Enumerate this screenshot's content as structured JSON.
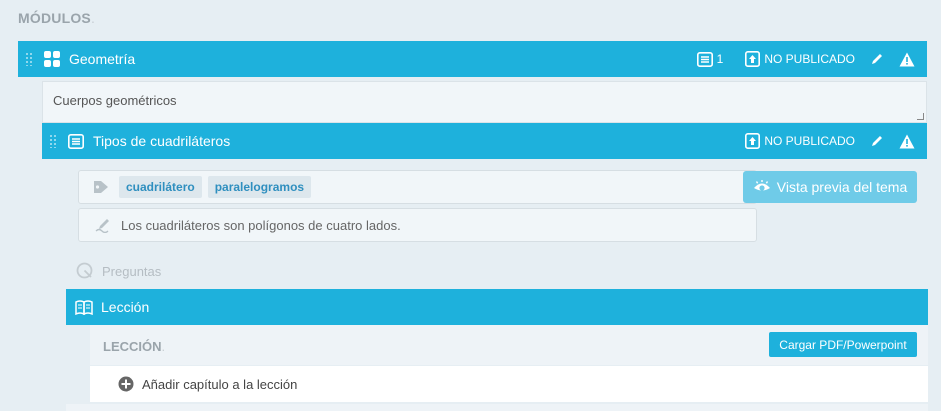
{
  "section": {
    "title": "MÓDULOS"
  },
  "module": {
    "title": "Geometría",
    "count": "1",
    "status": "NO PUBLICADO",
    "description": "Cuerpos geométricos"
  },
  "topic": {
    "title": "Tipos de cuadriláteros",
    "status": "NO PUBLICADO",
    "tags": [
      "cuadrilátero",
      "paralelogramos"
    ],
    "preview_label": "Vista previa del tema",
    "summary": "Los cuadriláteros son polígonos de cuatro lados."
  },
  "questions": {
    "label": "Preguntas"
  },
  "lesson": {
    "bar_label": "Lección",
    "panel_title": "LECCIÓN",
    "upload_label": "Cargar PDF/Powerpoint",
    "add_chapter_label": "Añadir capítulo a la lección"
  },
  "colors": {
    "accent": "#1eb1dc",
    "preview_button": "#6fcbe8",
    "background": "#e6eef3"
  },
  "icons": {
    "module": "grid-icon",
    "list": "list-icon",
    "publish": "publish-icon",
    "edit": "pencil-icon",
    "warning": "warning-icon",
    "tag": "tag-icon",
    "eye": "eye-icon",
    "summary": "edit-note-icon",
    "questions": "questions-icon",
    "book": "book-icon",
    "add": "plus-circle-icon"
  }
}
